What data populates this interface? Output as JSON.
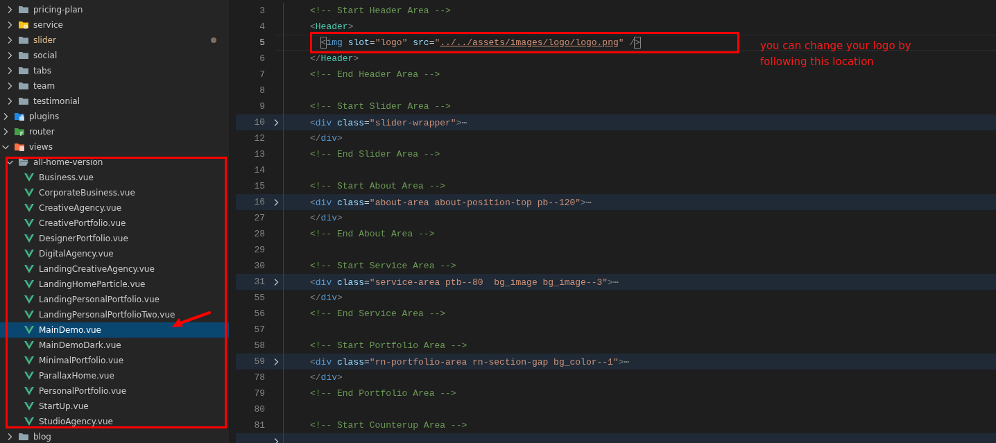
{
  "explorer": {
    "tree": [
      {
        "children": [
          {
            "label": "pricing-plan",
            "kind": "folder",
            "color": "#90a4ae",
            "expanded": false,
            "modified": false,
            "selected": false
          },
          {
            "label": "service",
            "kind": "folder-gear",
            "color": "#f9c21a",
            "expanded": false,
            "modified": false,
            "selected": false
          },
          {
            "label": "slider",
            "kind": "folder",
            "color": "#90a4ae",
            "expanded": false,
            "modified": true,
            "selected": false
          },
          {
            "label": "social",
            "kind": "folder",
            "color": "#90a4ae",
            "expanded": false,
            "modified": false,
            "selected": false
          },
          {
            "label": "tabs",
            "kind": "folder",
            "color": "#90a4ae",
            "expanded": false,
            "modified": false,
            "selected": false
          },
          {
            "label": "team",
            "kind": "folder",
            "color": "#90a4ae",
            "expanded": false,
            "modified": false,
            "selected": false
          },
          {
            "label": "testimonial",
            "kind": "folder",
            "color": "#90a4ae",
            "expanded": false,
            "modified": false,
            "selected": false
          }
        ]
      },
      {
        "label": "plugins",
        "kind": "folder-puzzle",
        "color": "#1e88e5",
        "expanded": false,
        "modified": false,
        "selected": false
      },
      {
        "label": "router",
        "kind": "folder-branch",
        "color": "#43a047",
        "expanded": false,
        "modified": false,
        "selected": false
      },
      {
        "label": "views",
        "kind": "folder-code",
        "color": "#ff7043",
        "expanded": true,
        "modified": false,
        "selected": false,
        "children": [
          {
            "label": "all-home-version",
            "kind": "folder-open",
            "color": "#90a4ae",
            "expanded": true,
            "modified": false,
            "selected": false,
            "children": [
              {
                "label": "Business.vue",
                "kind": "vue",
                "modified": false,
                "selected": false
              },
              {
                "label": "CorporateBusiness.vue",
                "kind": "vue",
                "modified": false,
                "selected": false
              },
              {
                "label": "CreativeAgency.vue",
                "kind": "vue",
                "modified": false,
                "selected": false
              },
              {
                "label": "CreativePortfolio.vue",
                "kind": "vue",
                "modified": false,
                "selected": false
              },
              {
                "label": "DesignerPortfolio.vue",
                "kind": "vue",
                "modified": false,
                "selected": false
              },
              {
                "label": "DigitalAgency.vue",
                "kind": "vue",
                "modified": false,
                "selected": false
              },
              {
                "label": "LandingCreativeAgency.vue",
                "kind": "vue",
                "modified": false,
                "selected": false
              },
              {
                "label": "LandingHomeParticle.vue",
                "kind": "vue",
                "modified": false,
                "selected": false
              },
              {
                "label": "LandingPersonalPortfolio.vue",
                "kind": "vue",
                "modified": false,
                "selected": false
              },
              {
                "label": "LandingPersonalPortfolioTwo.vue",
                "kind": "vue",
                "modified": false,
                "selected": false
              },
              {
                "label": "MainDemo.vue",
                "kind": "vue",
                "modified": false,
                "selected": true
              },
              {
                "label": "MainDemoDark.vue",
                "kind": "vue",
                "modified": false,
                "selected": false
              },
              {
                "label": "MinimalPortfolio.vue",
                "kind": "vue",
                "modified": false,
                "selected": false
              },
              {
                "label": "ParallaxHome.vue",
                "kind": "vue",
                "modified": false,
                "selected": false
              },
              {
                "label": "PersonalPortfolio.vue",
                "kind": "vue",
                "modified": false,
                "selected": false
              },
              {
                "label": "StartUp.vue",
                "kind": "vue",
                "modified": false,
                "selected": false
              },
              {
                "label": "StudioAgency.vue",
                "kind": "vue",
                "modified": false,
                "selected": false
              }
            ]
          },
          {
            "label": "blog",
            "kind": "folder",
            "color": "#90a4ae",
            "expanded": false,
            "modified": false,
            "selected": false
          }
        ]
      }
    ]
  },
  "editor": {
    "lines": [
      {
        "number": "3",
        "fold": false,
        "highlighted": false,
        "current": false,
        "tokens": [
          {
            "kind": "comment",
            "text": "<!-- Start Header Area -->"
          }
        ]
      },
      {
        "number": "4",
        "fold": false,
        "highlighted": false,
        "current": false,
        "tokens": [
          {
            "kind": "punct",
            "text": "<"
          },
          {
            "kind": "component",
            "text": "Header"
          },
          {
            "kind": "punct",
            "text": ">"
          }
        ]
      },
      {
        "number": "5",
        "fold": false,
        "highlighted": false,
        "current": true,
        "tokens": [
          {
            "kind": "bracket",
            "text": "  <"
          },
          {
            "kind": "tag",
            "text": "img"
          },
          {
            "kind": "attr",
            "text": " slot"
          },
          {
            "kind": "plain",
            "text": "="
          },
          {
            "kind": "string",
            "text": "\"logo\""
          },
          {
            "kind": "attr",
            "text": " src"
          },
          {
            "kind": "plain",
            "text": "="
          },
          {
            "kind": "string",
            "text": "\""
          },
          {
            "kind": "link",
            "text": "../../assets/images/logo/logo.png"
          },
          {
            "kind": "string",
            "text": "\""
          },
          {
            "kind": "punct",
            "text": " /"
          },
          {
            "kind": "bracket",
            "text": ">"
          }
        ]
      },
      {
        "number": "6",
        "fold": false,
        "highlighted": false,
        "current": false,
        "tokens": [
          {
            "kind": "punct",
            "text": "</"
          },
          {
            "kind": "component",
            "text": "Header"
          },
          {
            "kind": "punct",
            "text": ">"
          }
        ]
      },
      {
        "number": "7",
        "fold": false,
        "highlighted": false,
        "current": false,
        "tokens": [
          {
            "kind": "comment",
            "text": "<!-- End Header Area -->"
          }
        ]
      },
      {
        "number": "8",
        "fold": false,
        "highlighted": false,
        "current": false
      },
      {
        "number": "9",
        "fold": false,
        "highlighted": false,
        "current": false,
        "tokens": [
          {
            "kind": "comment",
            "text": "<!-- Start Slider Area -->"
          }
        ]
      },
      {
        "number": "10",
        "fold": true,
        "highlighted": true,
        "current": false,
        "tokens": [
          {
            "kind": "punct",
            "text": "<"
          },
          {
            "kind": "tag",
            "text": "div"
          },
          {
            "kind": "attr",
            "text": " class"
          },
          {
            "kind": "plain",
            "text": "="
          },
          {
            "kind": "string",
            "text": "\"slider-wrapper\""
          },
          {
            "kind": "punct",
            "text": ">"
          },
          {
            "kind": "ellipsis",
            "text": "⋯"
          }
        ]
      },
      {
        "number": "12",
        "fold": false,
        "highlighted": false,
        "current": false,
        "tokens": [
          {
            "kind": "punct",
            "text": "</"
          },
          {
            "kind": "tag",
            "text": "div"
          },
          {
            "kind": "punct",
            "text": ">"
          }
        ]
      },
      {
        "number": "13",
        "fold": false,
        "highlighted": false,
        "current": false,
        "tokens": [
          {
            "kind": "comment",
            "text": "<!-- End Slider Area -->"
          }
        ]
      },
      {
        "number": "14",
        "fold": false,
        "highlighted": false,
        "current": false
      },
      {
        "number": "15",
        "fold": false,
        "highlighted": false,
        "current": false,
        "tokens": [
          {
            "kind": "comment",
            "text": "<!-- Start About Area -->"
          }
        ]
      },
      {
        "number": "16",
        "fold": true,
        "highlighted": true,
        "current": false,
        "tokens": [
          {
            "kind": "punct",
            "text": "<"
          },
          {
            "kind": "tag",
            "text": "div"
          },
          {
            "kind": "attr",
            "text": " class"
          },
          {
            "kind": "plain",
            "text": "="
          },
          {
            "kind": "string",
            "text": "\"about-area about-position-top pb--120\""
          },
          {
            "kind": "punct",
            "text": ">"
          },
          {
            "kind": "ellipsis",
            "text": "⋯"
          }
        ]
      },
      {
        "number": "27",
        "fold": false,
        "highlighted": false,
        "current": false,
        "tokens": [
          {
            "kind": "punct",
            "text": "</"
          },
          {
            "kind": "tag",
            "text": "div"
          },
          {
            "kind": "punct",
            "text": ">"
          }
        ]
      },
      {
        "number": "28",
        "fold": false,
        "highlighted": false,
        "current": false,
        "tokens": [
          {
            "kind": "comment",
            "text": "<!-- End About Area -->"
          }
        ]
      },
      {
        "number": "29",
        "fold": false,
        "highlighted": false,
        "current": false
      },
      {
        "number": "30",
        "fold": false,
        "highlighted": false,
        "current": false,
        "tokens": [
          {
            "kind": "comment",
            "text": "<!-- Start Service Area -->"
          }
        ]
      },
      {
        "number": "31",
        "fold": true,
        "highlighted": true,
        "current": false,
        "tokens": [
          {
            "kind": "punct",
            "text": "<"
          },
          {
            "kind": "tag",
            "text": "div"
          },
          {
            "kind": "attr",
            "text": " class"
          },
          {
            "kind": "plain",
            "text": "="
          },
          {
            "kind": "string",
            "text": "\"service-area ptb--80  bg_image bg_image--3\""
          },
          {
            "kind": "punct",
            "text": ">"
          },
          {
            "kind": "ellipsis",
            "text": "⋯"
          }
        ]
      },
      {
        "number": "55",
        "fold": false,
        "highlighted": false,
        "current": false,
        "tokens": [
          {
            "kind": "punct",
            "text": "</"
          },
          {
            "kind": "tag",
            "text": "div"
          },
          {
            "kind": "punct",
            "text": ">"
          }
        ]
      },
      {
        "number": "56",
        "fold": false,
        "highlighted": false,
        "current": false,
        "tokens": [
          {
            "kind": "comment",
            "text": "<!-- End Service Area -->"
          }
        ]
      },
      {
        "number": "57",
        "fold": false,
        "highlighted": false,
        "current": false
      },
      {
        "number": "58",
        "fold": false,
        "highlighted": false,
        "current": false,
        "tokens": [
          {
            "kind": "comment",
            "text": "<!-- Start Portfolio Area -->"
          }
        ]
      },
      {
        "number": "59",
        "fold": true,
        "highlighted": true,
        "current": false,
        "tokens": [
          {
            "kind": "punct",
            "text": "<"
          },
          {
            "kind": "tag",
            "text": "div"
          },
          {
            "kind": "attr",
            "text": " class"
          },
          {
            "kind": "plain",
            "text": "="
          },
          {
            "kind": "string",
            "text": "\"rn-portfolio-area rn-section-gap bg_color--1\""
          },
          {
            "kind": "punct",
            "text": ">"
          },
          {
            "kind": "ellipsis",
            "text": "⋯"
          }
        ]
      },
      {
        "number": "78",
        "fold": false,
        "highlighted": false,
        "current": false,
        "tokens": [
          {
            "kind": "punct",
            "text": "</"
          },
          {
            "kind": "tag",
            "text": "div"
          },
          {
            "kind": "punct",
            "text": ">"
          }
        ]
      },
      {
        "number": "79",
        "fold": false,
        "highlighted": false,
        "current": false,
        "tokens": [
          {
            "kind": "comment",
            "text": "<!-- End Portfolio Area -->"
          }
        ]
      },
      {
        "number": "80",
        "fold": false,
        "highlighted": false,
        "current": false
      },
      {
        "number": "81",
        "fold": false,
        "highlighted": false,
        "current": false,
        "tokens": [
          {
            "kind": "comment",
            "text": "<!-- Start Counterup Area -->"
          }
        ]
      },
      {
        "fold": true,
        "highlighted": true,
        "current": false
      }
    ]
  },
  "annotation": {
    "note_lines": [
      "you can change your logo by",
      "following this location"
    ]
  }
}
